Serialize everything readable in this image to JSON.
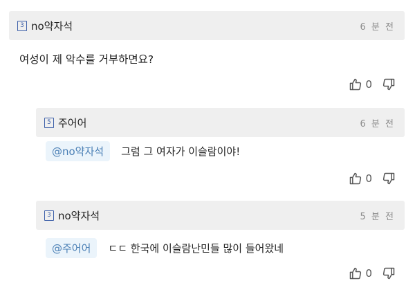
{
  "comments": [
    {
      "level_badge": "3",
      "username": "no약자석",
      "time": "6 분 전",
      "text": "여성이 제 악수를 거부하면요?",
      "like_count": "0"
    },
    {
      "level_badge": "5",
      "username": "주어어",
      "time": "6 분 전",
      "mention": "@no약자석",
      "text": "그럼 그 여자가 이슬람이야!",
      "like_count": "0"
    },
    {
      "level_badge": "3",
      "username": "no약자석",
      "time": "5 분 전",
      "mention": "@주어어",
      "text": "ㄷㄷ 한국에 이슬람난민들 많이 들어왔네",
      "like_count": "0"
    }
  ],
  "icons": {
    "like": "thumbs-up-icon",
    "dislike": "thumbs-down-icon",
    "level": "level-badge-icon"
  },
  "colors": {
    "header_bg": "#efefef",
    "mention_bg": "#ebf4fb",
    "mention_text": "#4a7fb5",
    "badge_blue": "#3b5ea8"
  }
}
